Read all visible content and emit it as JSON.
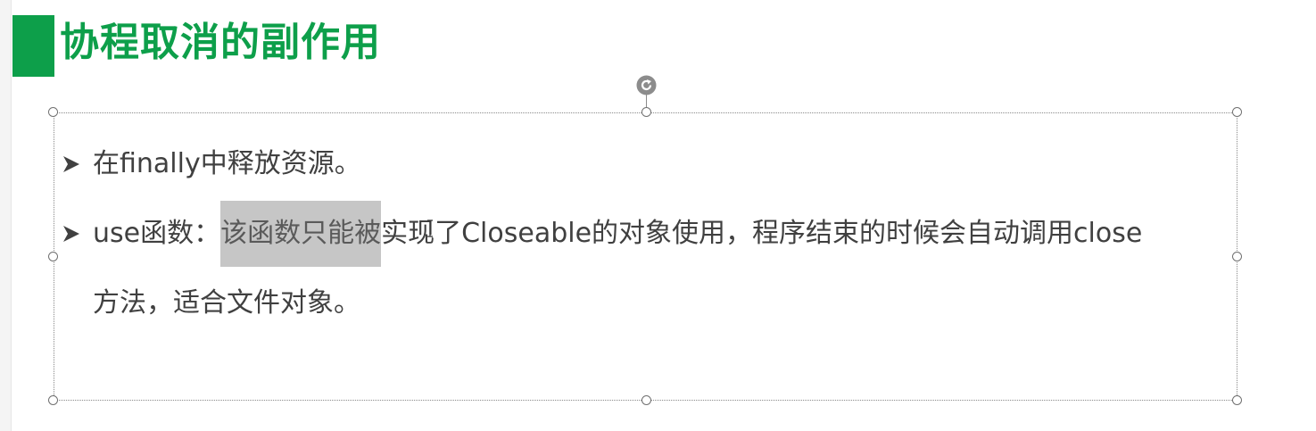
{
  "slide": {
    "title": "协程取消的副作用",
    "accent_color": "#0d9f4a",
    "text_color": "#404040",
    "highlight_color": "#c6c6c6"
  },
  "bullets": [
    {
      "icon": "arrowhead-bullet-icon",
      "text": "在finally中释放资源。"
    },
    {
      "icon": "arrowhead-bullet-icon",
      "lead": "use函数：",
      "highlighted": "该函数只能被",
      "rest": "实现了Closeable的对象使用，程序结束的时候会自动调用close",
      "continuation": "方法，适合文件对象。"
    }
  ]
}
